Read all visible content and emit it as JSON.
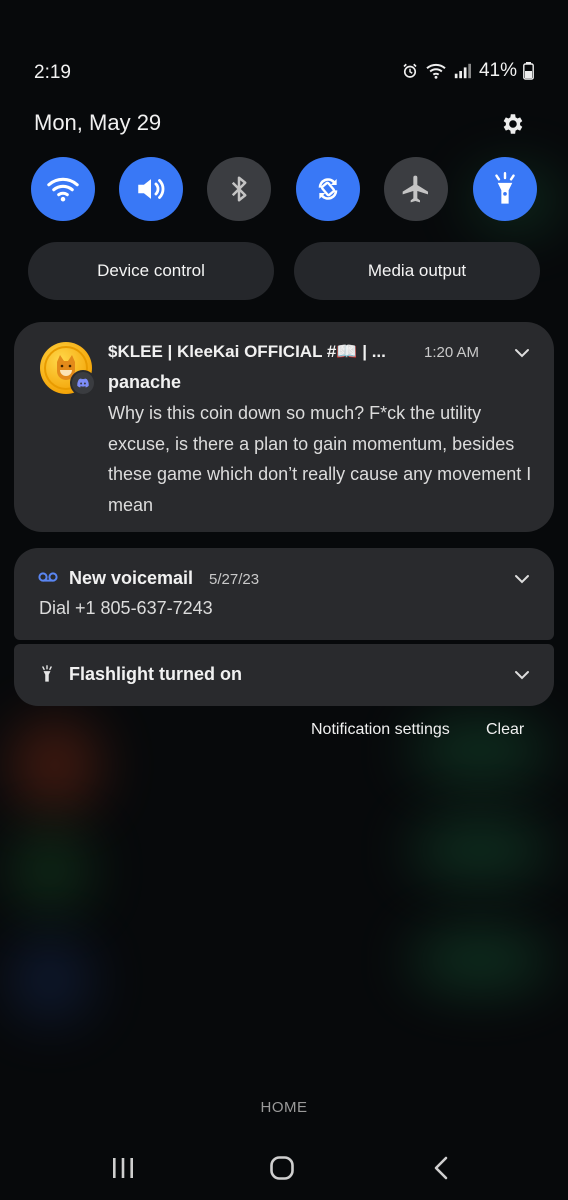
{
  "status_bar": {
    "time": "2:19",
    "battery": "41%"
  },
  "header": {
    "date": "Mon, May 29"
  },
  "quick_settings": [
    {
      "name": "Wi-Fi",
      "icon": "wifi-icon",
      "on": true
    },
    {
      "name": "Sound",
      "icon": "volume-icon",
      "on": true
    },
    {
      "name": "Bluetooth",
      "icon": "bluetooth-icon",
      "on": false
    },
    {
      "name": "Auto rotate",
      "icon": "rotate-icon",
      "on": true
    },
    {
      "name": "Airplane mode",
      "icon": "airplane-icon",
      "on": false
    },
    {
      "name": "Flashlight",
      "icon": "flashlight-icon",
      "on": true
    }
  ],
  "buttons": {
    "device_control": "Device control",
    "media_output": "Media output"
  },
  "notifications": {
    "message": {
      "title": "$KLEE | KleeKai OFFICIAL #📖 | ...",
      "time": "1:20 AM",
      "sender": "panache",
      "body": "Why is this coin down so much? F*ck the utility excuse, is there a plan to gain momentum, besides these game which don’t really cause any movement I mean"
    },
    "voicemail": {
      "title": "New voicemail",
      "date": "5/27/23",
      "body": "Dial +1 805-637-7243"
    },
    "flashlight": {
      "title": "Flashlight turned on"
    }
  },
  "notification_actions": {
    "settings": "Notification settings",
    "clear": "Clear"
  },
  "nav": {
    "home_label": "HOME"
  },
  "colors": {
    "accent": "#3978f6",
    "tile_off": "#3b3d41",
    "card": "#292a2d",
    "background": "#07090b"
  }
}
